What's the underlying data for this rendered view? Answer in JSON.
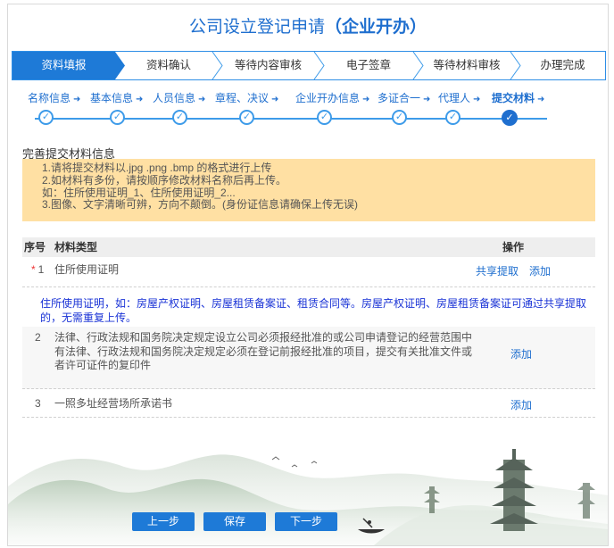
{
  "title": {
    "main": "公司设立登记申请",
    "highlight": "（企业开办）"
  },
  "progress_steps": [
    "资料填报",
    "资料确认",
    "等待内容审核",
    "电子签章",
    "等待材料审核",
    "办理完成"
  ],
  "sub_steps": [
    "名称信息",
    "基本信息",
    "人员信息",
    "章程、决议",
    "企业开办信息",
    "多证合一",
    "代理人",
    "提交材料"
  ],
  "section_title": "完善提交材料信息",
  "notice_lines": [
    "1.请将提交材料以.jpg .png .bmp 的格式进行上传",
    "2.如材料有多份，请按顺序修改材料名称后再上传。",
    "如：住所使用证明_1、住所使用证明_2...",
    "3.图像、文字清晰可辨，方向不颠倒。(身份证信息请确保上传无误)"
  ],
  "table": {
    "col_index": "序号",
    "col_type": "材料类型",
    "col_action": "操作",
    "required_mark": "*",
    "rows": [
      {
        "index": "1",
        "name_lines": [
          "住所使用证明"
        ],
        "share_link": "共享提取",
        "add_link": "添加"
      },
      {
        "index": "2",
        "name_lines": [
          "法律、行政法规和国务院决定规定设立公司必须报经批准的或公司申请登记的经营范围中",
          "有法律、行政法规和国务院决定规定必须在登记前报经批准的项目，提交有关批准文件或",
          "者许可证件的复印件"
        ],
        "add_link": "添加"
      },
      {
        "index": "3",
        "name_lines": [
          "一照多址经营场所承诺书"
        ],
        "add_link": "添加"
      }
    ],
    "hint_text": "住所使用证明，如：房屋产权证明、房屋租赁备案证、租赁合同等。房屋产权证明、房屋租赁备案证可通过共享提取的，无需重复上传。"
  },
  "buttons": {
    "prev": "上一步",
    "save": "保存",
    "next": "下一步"
  },
  "colors": {
    "primary": "#1e7ad7",
    "notice_bg": "#ffe0a3",
    "hint": "#1a33d6"
  }
}
